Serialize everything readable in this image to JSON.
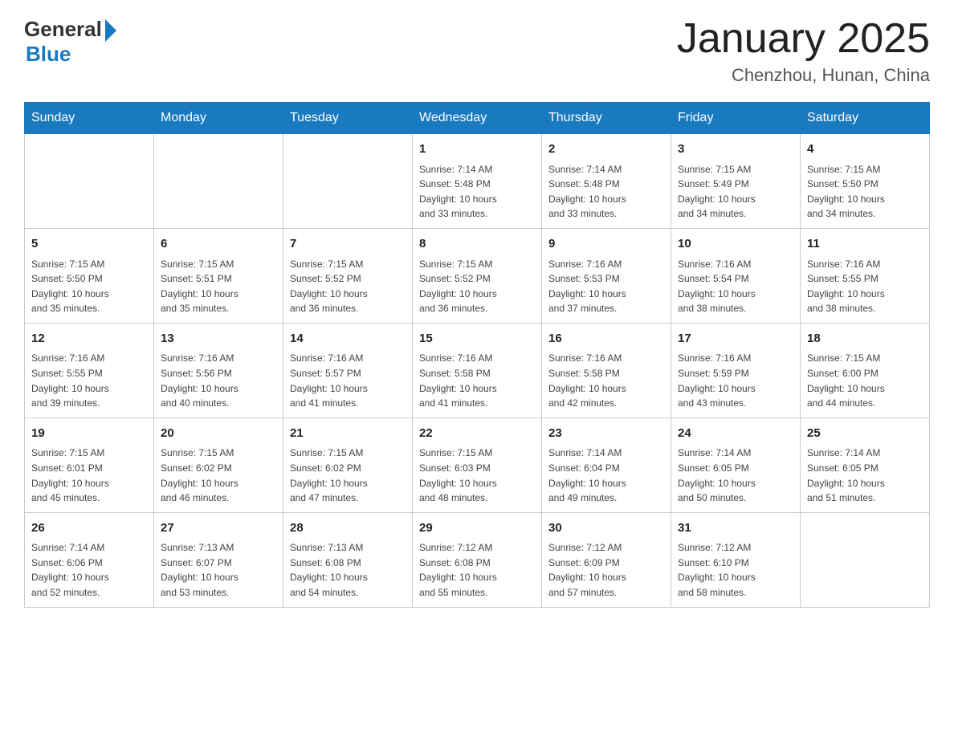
{
  "header": {
    "logo_general": "General",
    "logo_blue": "Blue",
    "month_title": "January 2025",
    "location": "Chenzhou, Hunan, China"
  },
  "days_of_week": [
    "Sunday",
    "Monday",
    "Tuesday",
    "Wednesday",
    "Thursday",
    "Friday",
    "Saturday"
  ],
  "weeks": [
    [
      {
        "day": "",
        "info": ""
      },
      {
        "day": "",
        "info": ""
      },
      {
        "day": "",
        "info": ""
      },
      {
        "day": "1",
        "info": "Sunrise: 7:14 AM\nSunset: 5:48 PM\nDaylight: 10 hours\nand 33 minutes."
      },
      {
        "day": "2",
        "info": "Sunrise: 7:14 AM\nSunset: 5:48 PM\nDaylight: 10 hours\nand 33 minutes."
      },
      {
        "day": "3",
        "info": "Sunrise: 7:15 AM\nSunset: 5:49 PM\nDaylight: 10 hours\nand 34 minutes."
      },
      {
        "day": "4",
        "info": "Sunrise: 7:15 AM\nSunset: 5:50 PM\nDaylight: 10 hours\nand 34 minutes."
      }
    ],
    [
      {
        "day": "5",
        "info": "Sunrise: 7:15 AM\nSunset: 5:50 PM\nDaylight: 10 hours\nand 35 minutes."
      },
      {
        "day": "6",
        "info": "Sunrise: 7:15 AM\nSunset: 5:51 PM\nDaylight: 10 hours\nand 35 minutes."
      },
      {
        "day": "7",
        "info": "Sunrise: 7:15 AM\nSunset: 5:52 PM\nDaylight: 10 hours\nand 36 minutes."
      },
      {
        "day": "8",
        "info": "Sunrise: 7:15 AM\nSunset: 5:52 PM\nDaylight: 10 hours\nand 36 minutes."
      },
      {
        "day": "9",
        "info": "Sunrise: 7:16 AM\nSunset: 5:53 PM\nDaylight: 10 hours\nand 37 minutes."
      },
      {
        "day": "10",
        "info": "Sunrise: 7:16 AM\nSunset: 5:54 PM\nDaylight: 10 hours\nand 38 minutes."
      },
      {
        "day": "11",
        "info": "Sunrise: 7:16 AM\nSunset: 5:55 PM\nDaylight: 10 hours\nand 38 minutes."
      }
    ],
    [
      {
        "day": "12",
        "info": "Sunrise: 7:16 AM\nSunset: 5:55 PM\nDaylight: 10 hours\nand 39 minutes."
      },
      {
        "day": "13",
        "info": "Sunrise: 7:16 AM\nSunset: 5:56 PM\nDaylight: 10 hours\nand 40 minutes."
      },
      {
        "day": "14",
        "info": "Sunrise: 7:16 AM\nSunset: 5:57 PM\nDaylight: 10 hours\nand 41 minutes."
      },
      {
        "day": "15",
        "info": "Sunrise: 7:16 AM\nSunset: 5:58 PM\nDaylight: 10 hours\nand 41 minutes."
      },
      {
        "day": "16",
        "info": "Sunrise: 7:16 AM\nSunset: 5:58 PM\nDaylight: 10 hours\nand 42 minutes."
      },
      {
        "day": "17",
        "info": "Sunrise: 7:16 AM\nSunset: 5:59 PM\nDaylight: 10 hours\nand 43 minutes."
      },
      {
        "day": "18",
        "info": "Sunrise: 7:15 AM\nSunset: 6:00 PM\nDaylight: 10 hours\nand 44 minutes."
      }
    ],
    [
      {
        "day": "19",
        "info": "Sunrise: 7:15 AM\nSunset: 6:01 PM\nDaylight: 10 hours\nand 45 minutes."
      },
      {
        "day": "20",
        "info": "Sunrise: 7:15 AM\nSunset: 6:02 PM\nDaylight: 10 hours\nand 46 minutes."
      },
      {
        "day": "21",
        "info": "Sunrise: 7:15 AM\nSunset: 6:02 PM\nDaylight: 10 hours\nand 47 minutes."
      },
      {
        "day": "22",
        "info": "Sunrise: 7:15 AM\nSunset: 6:03 PM\nDaylight: 10 hours\nand 48 minutes."
      },
      {
        "day": "23",
        "info": "Sunrise: 7:14 AM\nSunset: 6:04 PM\nDaylight: 10 hours\nand 49 minutes."
      },
      {
        "day": "24",
        "info": "Sunrise: 7:14 AM\nSunset: 6:05 PM\nDaylight: 10 hours\nand 50 minutes."
      },
      {
        "day": "25",
        "info": "Sunrise: 7:14 AM\nSunset: 6:05 PM\nDaylight: 10 hours\nand 51 minutes."
      }
    ],
    [
      {
        "day": "26",
        "info": "Sunrise: 7:14 AM\nSunset: 6:06 PM\nDaylight: 10 hours\nand 52 minutes."
      },
      {
        "day": "27",
        "info": "Sunrise: 7:13 AM\nSunset: 6:07 PM\nDaylight: 10 hours\nand 53 minutes."
      },
      {
        "day": "28",
        "info": "Sunrise: 7:13 AM\nSunset: 6:08 PM\nDaylight: 10 hours\nand 54 minutes."
      },
      {
        "day": "29",
        "info": "Sunrise: 7:12 AM\nSunset: 6:08 PM\nDaylight: 10 hours\nand 55 minutes."
      },
      {
        "day": "30",
        "info": "Sunrise: 7:12 AM\nSunset: 6:09 PM\nDaylight: 10 hours\nand 57 minutes."
      },
      {
        "day": "31",
        "info": "Sunrise: 7:12 AM\nSunset: 6:10 PM\nDaylight: 10 hours\nand 58 minutes."
      },
      {
        "day": "",
        "info": ""
      }
    ]
  ]
}
